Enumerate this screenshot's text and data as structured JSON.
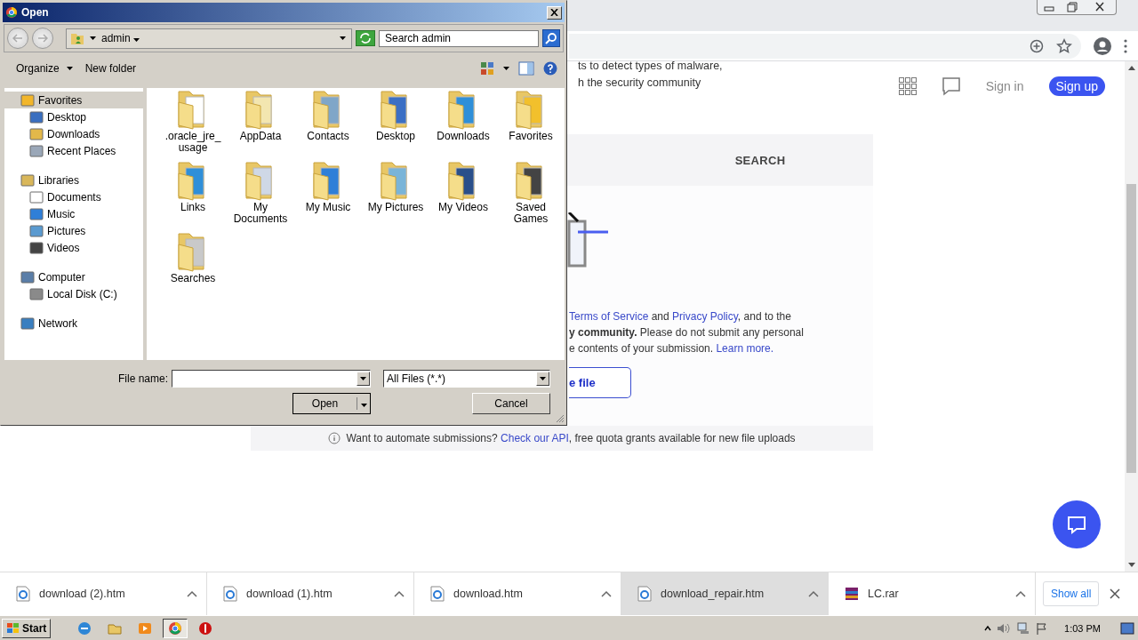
{
  "page": {
    "intro_lines": [
      "ts to detect types of malware,",
      "h the security community"
    ],
    "nav": {
      "sign_in": "Sign in",
      "sign_up": "Sign up"
    },
    "tab_label": "SEARCH",
    "terms_lines": [
      [
        {
          "kind": "link",
          "text": "Terms of Service"
        },
        {
          "kind": "text",
          "text": " and "
        },
        {
          "kind": "link",
          "text": "Privacy Policy"
        },
        {
          "kind": "text",
          "text": ", and to the"
        }
      ],
      [
        {
          "kind": "bold",
          "text": "y community."
        },
        {
          "kind": "text",
          "text": " Please do not submit any personal"
        }
      ],
      [
        {
          "kind": "text",
          "text": "e contents of your submission. "
        },
        {
          "kind": "link",
          "text": "Learn more."
        }
      ]
    ],
    "upload_button": "e file",
    "api_note": {
      "text": "Want to automate submissions? ",
      "link": "Check our API",
      "rest": ", free quota grants available for new file uploads"
    }
  },
  "dialog": {
    "title": "Open",
    "location": "admin",
    "search": {
      "placeholder": "Search admin"
    },
    "toolbar": {
      "organize": "Organize",
      "new_folder": "New folder"
    },
    "nav_pane": [
      {
        "label": "Favorites",
        "selected": true,
        "children": [
          {
            "label": "Desktop",
            "selected": false
          },
          {
            "label": "Downloads",
            "selected": false
          },
          {
            "label": "Recent Places",
            "selected": false
          }
        ]
      },
      {
        "label": "Libraries",
        "selected": false,
        "children": [
          {
            "label": "Documents",
            "selected": false
          },
          {
            "label": "Music",
            "selected": false
          },
          {
            "label": "Pictures",
            "selected": false
          },
          {
            "label": "Videos",
            "selected": false
          }
        ]
      },
      {
        "label": "Computer",
        "selected": false,
        "children": [
          {
            "label": "Local Disk (C:)",
            "selected": false
          }
        ]
      },
      {
        "label": "Network",
        "selected": false
      }
    ],
    "folders": [
      ".oracle_jre_usage",
      "AppData",
      "Contacts",
      "Desktop",
      "Downloads",
      "Favorites",
      "Links",
      "My Documents",
      "My Music",
      "My Pictures",
      "My Videos",
      "Saved Games",
      "Searches"
    ],
    "file_name_label": "File name:",
    "filter": "All Files (*.*)",
    "open": "Open",
    "cancel": "Cancel"
  },
  "downloads": {
    "items": [
      {
        "label": "download (2).htm",
        "kind": "htm",
        "hovered": false
      },
      {
        "label": "download (1).htm",
        "kind": "htm",
        "hovered": false
      },
      {
        "label": "download.htm",
        "kind": "htm",
        "hovered": false
      },
      {
        "label": "download_repair.htm",
        "kind": "htm",
        "hovered": true
      },
      {
        "label": "LC.rar",
        "kind": "rar",
        "hovered": false
      }
    ],
    "show_all": "Show all"
  },
  "taskbar": {
    "start": "Start",
    "apps": [
      {
        "selected": false
      },
      {
        "selected": false
      },
      {
        "selected": false
      },
      {
        "selected": true
      },
      {
        "selected": false
      }
    ],
    "clock": "1:03 PM"
  }
}
